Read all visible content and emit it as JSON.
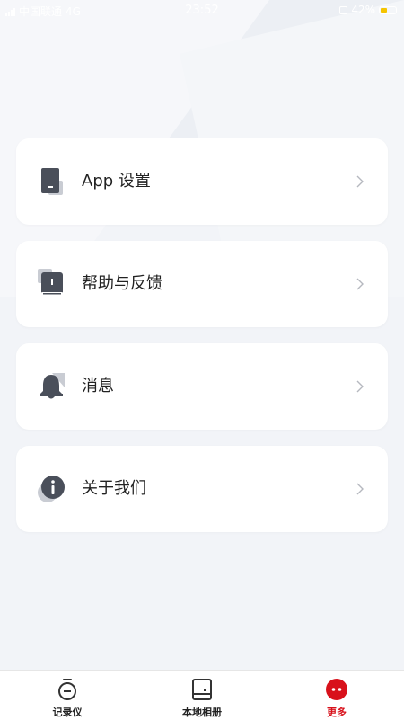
{
  "status_bar": {
    "carrier": "中国联通",
    "network": "4G",
    "time": "23:52",
    "battery": "42%",
    "battery_level": 0.42
  },
  "menu": {
    "items": [
      {
        "label": "App 设置",
        "icon": "phone-settings-icon"
      },
      {
        "label": "帮助与反馈",
        "icon": "book-icon"
      },
      {
        "label": "消息",
        "icon": "bell-icon"
      },
      {
        "label": "关于我们",
        "icon": "info-icon"
      }
    ]
  },
  "tab_bar": {
    "tabs": [
      {
        "label": "记录仪",
        "icon": "dashcam-icon",
        "active": false
      },
      {
        "label": "本地相册",
        "icon": "album-icon",
        "active": false
      },
      {
        "label": "更多",
        "icon": "more-icon",
        "active": true
      }
    ]
  },
  "colors": {
    "accent": "#d8111b",
    "icon": "#4a4f5a",
    "background": "#f2f4f8",
    "card": "#ffffff"
  }
}
